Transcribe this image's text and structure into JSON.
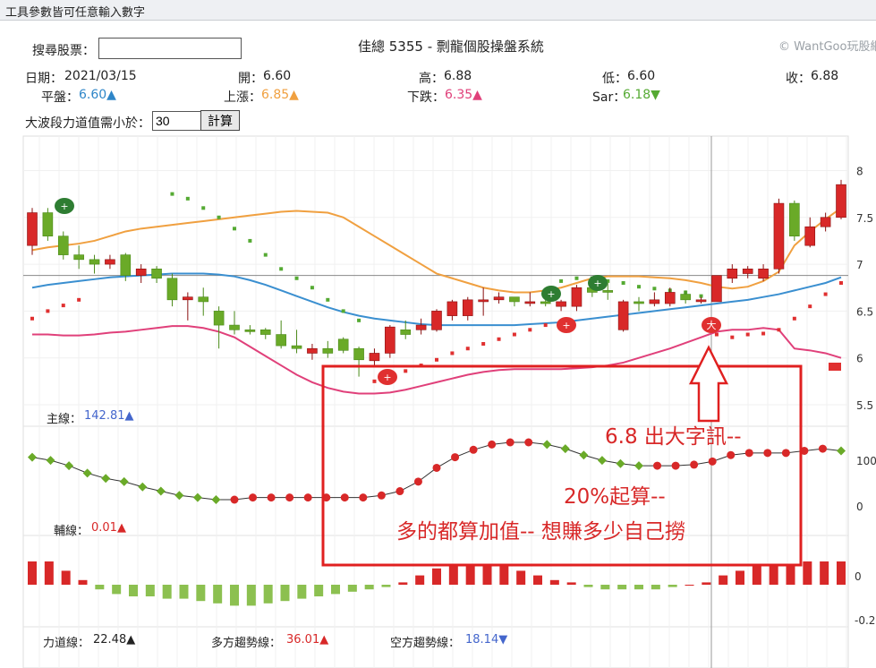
{
  "window": {
    "title": "工具參數皆可任意輸入數字"
  },
  "header": {
    "search_label": "搜尋股票：",
    "search_value": "",
    "stock_title": "佳總 5355 - 剽龍個股操盤系統",
    "watermark": "© WantGoo玩股網"
  },
  "quote": {
    "date_label": "日期：",
    "date": "2021/03/15",
    "open_label": "開：",
    "open": "6.60",
    "high_label": "高：",
    "high": "6.88",
    "low_label": "低：",
    "low": "6.60",
    "close_label": "收：",
    "close": "6.88",
    "flat_label": "平盤：",
    "flat": "6.60▲",
    "up_label": "上漲：",
    "up": "6.85▲",
    "down_label": "下跌：",
    "down": "6.35▲",
    "sar_label": "Sar：",
    "sar": "6.18▼"
  },
  "params": {
    "label": "大波段力道值需小於：",
    "value": "30",
    "button": "計算"
  },
  "panels": {
    "main_label": "主線：",
    "main_value": "142.81▲",
    "aux_label": "輔線：",
    "aux_value": "0.01▲",
    "force_label": "力道線：",
    "force_value": "22.48▲",
    "bull_label": "多方趨勢線：",
    "bull_value": "36.01▲",
    "bear_label": "空方趨勢線：",
    "bear_value": "18.14▼"
  },
  "annotation": {
    "line1": "6.8  出大字訊--",
    "line2": "20%起算--",
    "line3": "多的都算加值--  想賺多少自己撈"
  },
  "colors": {
    "up": "#d82828",
    "down": "#6aaa28",
    "orange_line": "#f0a040",
    "blue_line": "#3a8fd0",
    "pink_line": "#e0407a",
    "marker": "#d82828"
  },
  "chart_data": {
    "type": "candlestick",
    "ylim": [
      5.5,
      8.1
    ],
    "price_ticks": [
      "8",
      "7.5",
      "7",
      "6.5",
      "6",
      "5.5"
    ],
    "candles": [
      [
        7.2,
        7.55,
        7.6,
        7.1
      ],
      [
        7.55,
        7.3,
        7.6,
        7.25
      ],
      [
        7.3,
        7.1,
        7.35,
        7.05
      ],
      [
        7.1,
        7.05,
        7.2,
        6.95
      ],
      [
        7.05,
        7.0,
        7.1,
        6.9
      ],
      [
        7.0,
        7.05,
        7.1,
        6.95
      ],
      [
        7.1,
        6.88,
        7.12,
        6.82
      ],
      [
        6.88,
        6.95,
        7.0,
        6.8
      ],
      [
        6.95,
        6.85,
        6.98,
        6.8
      ],
      [
        6.85,
        6.62,
        6.9,
        6.55
      ],
      [
        6.62,
        6.65,
        6.7,
        6.4
      ],
      [
        6.65,
        6.6,
        6.75,
        6.45
      ],
      [
        6.5,
        6.35,
        6.55,
        6.1
      ],
      [
        6.35,
        6.3,
        6.5,
        6.25
      ],
      [
        6.3,
        6.28,
        6.35,
        6.25
      ],
      [
        6.3,
        6.25,
        6.32,
        6.2
      ],
      [
        6.25,
        6.13,
        6.4,
        6.1
      ],
      [
        6.13,
        6.1,
        6.3,
        6.05
      ],
      [
        6.05,
        6.1,
        6.15,
        5.98
      ],
      [
        6.1,
        6.05,
        6.18,
        6.0
      ],
      [
        6.2,
        6.08,
        6.22,
        6.05
      ],
      [
        6.1,
        5.98,
        6.12,
        5.8
      ],
      [
        5.97,
        6.05,
        6.1,
        5.9
      ],
      [
        6.05,
        6.33,
        6.35,
        6.0
      ],
      [
        6.3,
        6.25,
        6.4,
        6.2
      ],
      [
        6.3,
        6.35,
        6.42,
        6.25
      ],
      [
        6.3,
        6.5,
        6.52,
        6.28
      ],
      [
        6.45,
        6.6,
        6.62,
        6.4
      ],
      [
        6.45,
        6.62,
        6.65,
        6.4
      ],
      [
        6.6,
        6.62,
        6.75,
        6.45
      ],
      [
        6.62,
        6.65,
        6.7,
        6.58
      ],
      [
        6.65,
        6.6,
        6.65,
        6.55
      ],
      [
        6.6,
        6.6,
        6.7,
        6.55
      ],
      [
        6.6,
        6.58,
        6.62,
        6.55
      ],
      [
        6.55,
        6.6,
        6.62,
        6.5
      ],
      [
        6.55,
        6.75,
        6.78,
        6.5
      ],
      [
        6.75,
        6.7,
        6.85,
        6.65
      ],
      [
        6.72,
        6.7,
        6.8,
        6.62
      ],
      [
        6.3,
        6.6,
        6.62,
        6.28
      ],
      [
        6.6,
        6.58,
        6.65,
        6.5
      ],
      [
        6.58,
        6.62,
        6.7,
        6.55
      ],
      [
        6.58,
        6.7,
        6.75,
        6.55
      ],
      [
        6.68,
        6.62,
        6.72,
        6.58
      ],
      [
        6.6,
        6.62,
        6.65,
        6.58
      ],
      [
        6.6,
        6.88,
        6.88,
        6.6
      ],
      [
        6.85,
        6.95,
        7.0,
        6.8
      ],
      [
        6.9,
        6.95,
        6.98,
        6.85
      ],
      [
        6.85,
        6.95,
        7.0,
        6.82
      ],
      [
        6.95,
        7.65,
        7.7,
        6.9
      ],
      [
        7.65,
        7.3,
        7.68,
        7.25
      ],
      [
        7.2,
        7.4,
        7.5,
        7.18
      ],
      [
        7.4,
        7.5,
        7.55,
        7.35
      ],
      [
        7.5,
        7.85,
        7.9,
        7.48
      ]
    ],
    "orange_ma": [
      7.15,
      7.18,
      7.2,
      7.22,
      7.25,
      7.3,
      7.35,
      7.38,
      7.4,
      7.42,
      7.44,
      7.46,
      7.48,
      7.5,
      7.52,
      7.54,
      7.56,
      7.57,
      7.56,
      7.55,
      7.5,
      7.4,
      7.3,
      7.2,
      7.1,
      7.0,
      6.9,
      6.85,
      6.8,
      6.75,
      6.72,
      6.7,
      6.7,
      6.72,
      6.75,
      6.8,
      6.85,
      6.87,
      6.87,
      6.87,
      6.86,
      6.85,
      6.83,
      6.8,
      6.76,
      6.74,
      6.76,
      6.82,
      6.92,
      7.2,
      7.35,
      7.48,
      7.6
    ],
    "blue_ma": [
      6.75,
      6.78,
      6.8,
      6.82,
      6.84,
      6.86,
      6.87,
      6.88,
      6.89,
      6.9,
      6.9,
      6.9,
      6.89,
      6.87,
      6.83,
      6.78,
      6.72,
      6.66,
      6.6,
      6.54,
      6.49,
      6.45,
      6.42,
      6.4,
      6.38,
      6.36,
      6.35,
      6.35,
      6.35,
      6.35,
      6.35,
      6.35,
      6.36,
      6.37,
      6.38,
      6.4,
      6.42,
      6.44,
      6.46,
      6.48,
      6.5,
      6.52,
      6.54,
      6.56,
      6.58,
      6.6,
      6.62,
      6.65,
      6.68,
      6.72,
      6.76,
      6.8,
      6.86
    ],
    "pink_ma": [
      6.25,
      6.25,
      6.24,
      6.24,
      6.25,
      6.27,
      6.28,
      6.3,
      6.32,
      6.34,
      6.34,
      6.32,
      6.28,
      6.22,
      6.12,
      6.02,
      5.92,
      5.82,
      5.74,
      5.68,
      5.64,
      5.62,
      5.62,
      5.63,
      5.66,
      5.7,
      5.74,
      5.78,
      5.82,
      5.85,
      5.87,
      5.88,
      5.88,
      5.88,
      5.88,
      5.89,
      5.9,
      5.92,
      5.95,
      6.0,
      6.05,
      6.1,
      6.16,
      6.22,
      6.28,
      6.3,
      6.3,
      6.32,
      6.3,
      6.1,
      6.08,
      6.05,
      6.0
    ],
    "sar_dots": [
      6.42,
      6.5,
      6.56,
      6.62,
      null,
      null,
      null,
      null,
      null,
      7.75,
      7.7,
      7.6,
      7.5,
      7.38,
      7.25,
      7.1,
      6.95,
      6.85,
      6.75,
      6.62,
      6.5,
      6.4,
      5.75,
      5.8,
      5.86,
      5.92,
      5.98,
      6.05,
      6.1,
      6.15,
      6.2,
      6.25,
      6.3,
      6.35,
      6.82,
      6.85,
      6.85,
      6.82,
      6.8,
      6.76,
      6.74,
      6.72,
      6.7,
      6.66,
      6.25,
      6.22,
      6.25,
      6.26,
      6.3,
      6.42,
      6.55,
      6.68,
      6.8
    ],
    "main_line": [
      118,
      115,
      110,
      103,
      98,
      95,
      90,
      86,
      82,
      80,
      78,
      78,
      80,
      80,
      80,
      80,
      80,
      80,
      80,
      82,
      86,
      95,
      108,
      118,
      125,
      130,
      132,
      132,
      130,
      126,
      120,
      115,
      112,
      110,
      110,
      110,
      111,
      114,
      120,
      122,
      122,
      122,
      124,
      126,
      124
    ],
    "aux_bars": [
      0.1,
      0.1,
      0.06,
      0.02,
      -0.02,
      -0.04,
      -0.05,
      -0.05,
      -0.06,
      -0.06,
      -0.07,
      -0.08,
      -0.09,
      -0.09,
      -0.08,
      -0.07,
      -0.06,
      -0.05,
      -0.04,
      -0.03,
      -0.02,
      -0.01,
      0.01,
      0.04,
      0.07,
      0.09,
      0.09,
      0.09,
      0.08,
      0.06,
      0.04,
      0.02,
      0.01,
      -0.01,
      -0.02,
      -0.02,
      -0.02,
      -0.02,
      -0.01,
      0.0,
      0.01,
      0.04,
      0.06,
      0.08,
      0.08,
      0.09,
      0.1,
      0.1,
      0.1
    ]
  }
}
